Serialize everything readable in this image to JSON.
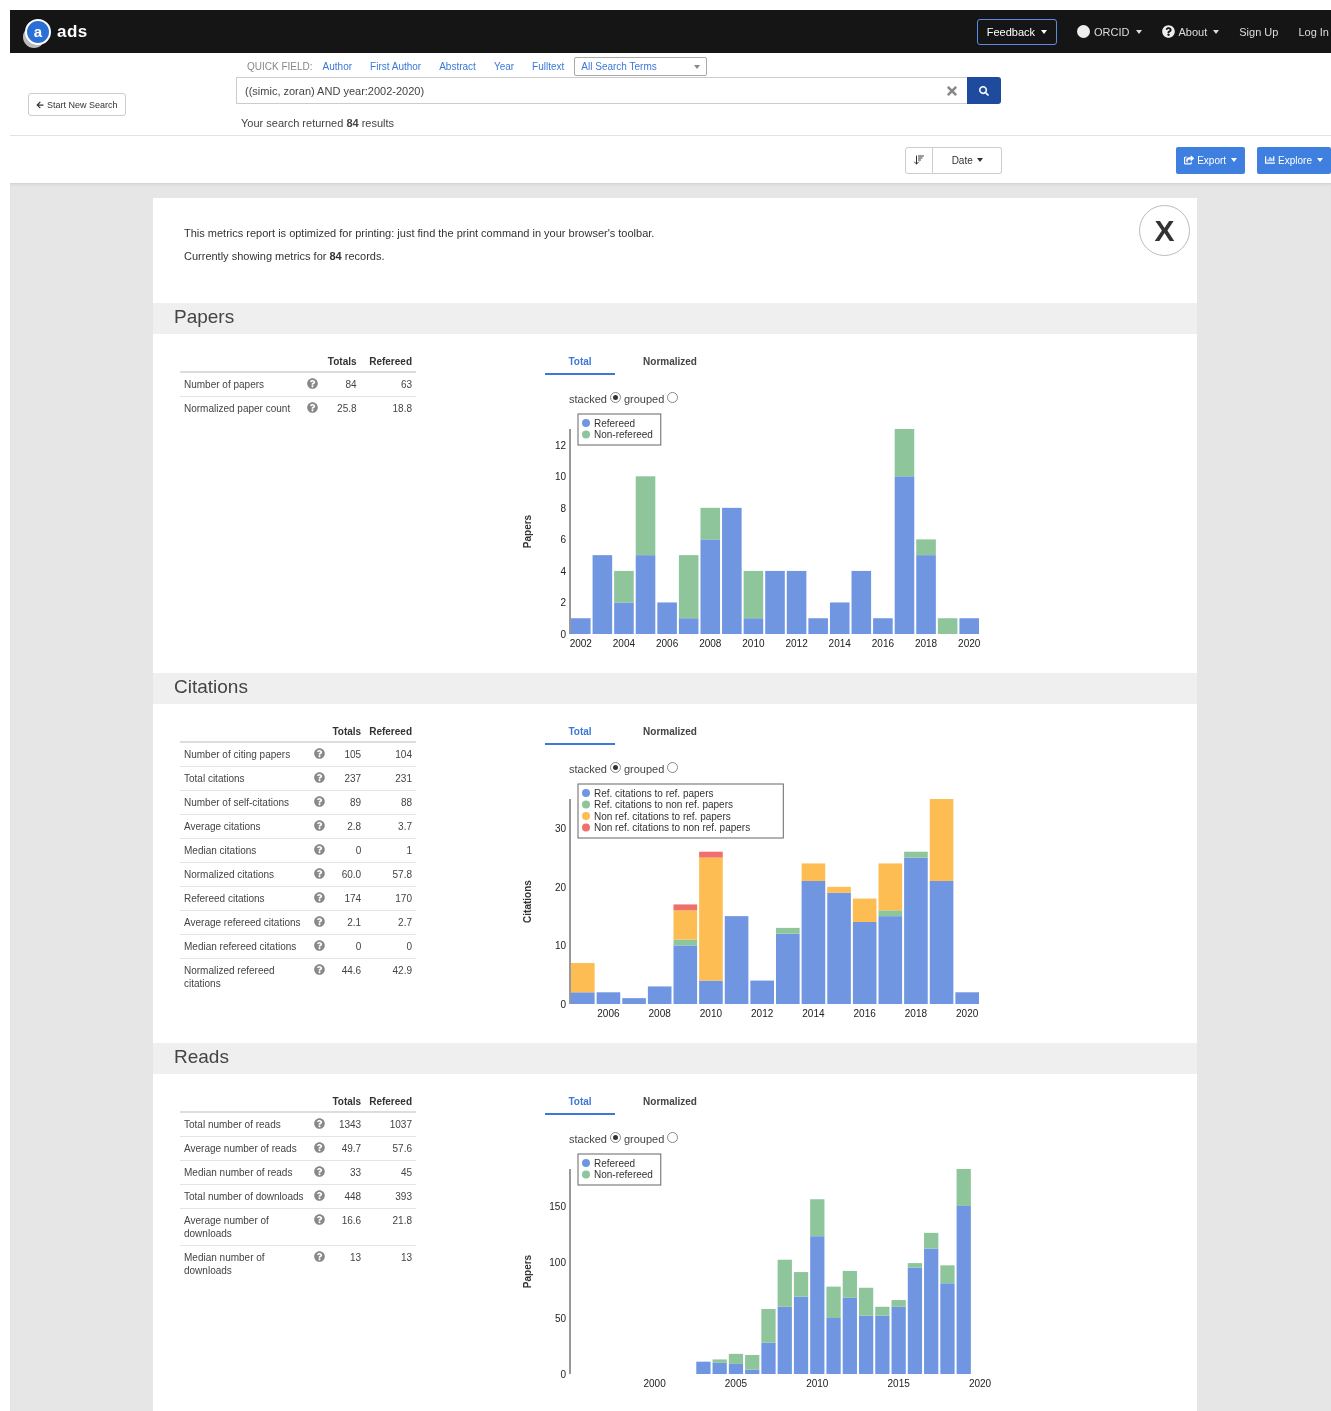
{
  "navbar": {
    "logo_mark": "a",
    "logo_text": "ads",
    "items": [
      {
        "label": "Feedback",
        "kind": "boxed",
        "caret": true
      },
      {
        "label": "ORCID",
        "kind": "orcid",
        "caret": true
      },
      {
        "label": "About",
        "kind": "help",
        "caret": true
      },
      {
        "label": "Sign Up",
        "kind": "link",
        "caret": false
      },
      {
        "label": "Log In",
        "kind": "link",
        "caret": false
      }
    ]
  },
  "search": {
    "start_new_search": "Start New Search",
    "quick_field_label": "QUICK FIELD:",
    "quick_fields": [
      "Author",
      "First Author",
      "Abstract",
      "Year",
      "Fulltext"
    ],
    "field_select": "All Search Terms",
    "query": "((simic, zoran) AND year:2002-2020)",
    "result": "Your search returned **84** results"
  },
  "toolbar": {
    "sort": "Date",
    "export": "Export",
    "explore": "Explore"
  },
  "report": {
    "close": "X",
    "notes": [
      "This metrics report is optimized for printing: just find the print command in your browser's toolbar.",
      "Currently showing metrics for **84** records."
    ],
    "sections": [
      {
        "title": "Papers",
        "table": {
          "columns": [
            "Totals",
            "Refereed"
          ],
          "rows": [
            {
              "label": "Number of papers",
              "totals": "84",
              "refereed": "63"
            },
            {
              "label": "Normalized paper count",
              "totals": "25.8",
              "refereed": "18.8"
            }
          ]
        },
        "tabs": [
          {
            "label": "Total",
            "selected": true
          },
          {
            "label": "Normalized",
            "selected": false
          }
        ],
        "options": [
          {
            "label": "stacked",
            "selected": true
          },
          {
            "label": "grouped",
            "selected": false
          }
        ],
        "chart_data": {
          "type": "bar",
          "ylabel": "Papers",
          "stacked": true,
          "legend": "upper left",
          "x": [
            2002,
            2003,
            2004,
            2005,
            2006,
            2007,
            2008,
            2009,
            2010,
            2011,
            2012,
            2013,
            2014,
            2015,
            2016,
            2017,
            2018,
            2019,
            2020
          ],
          "xlim": [
            2001.5,
            2020.5
          ],
          "ylim": [
            0,
            13
          ],
          "xticks": [
            2002,
            2004,
            2006,
            2008,
            2010,
            2012,
            2014,
            2016,
            2018,
            2020
          ],
          "yticks": [
            0,
            2,
            4,
            6,
            8,
            10,
            12
          ],
          "series": [
            {
              "name": "Refereed",
              "color": "#7096e2",
              "values": [
                1,
                5,
                2,
                5,
                2,
                1,
                6,
                8,
                1,
                4,
                4,
                1,
                2,
                4,
                1,
                10,
                5,
                0,
                1
              ]
            },
            {
              "name": "Non-refereed",
              "color": "#8ec59b",
              "values": [
                0,
                0,
                2,
                5,
                0,
                4,
                2,
                0,
                3,
                0,
                0,
                0,
                0,
                0,
                0,
                3,
                1,
                1,
                0
              ]
            }
          ]
        }
      },
      {
        "title": "Citations",
        "table": {
          "columns": [
            "Totals",
            "Refereed"
          ],
          "rows": [
            {
              "label": "Number of citing papers",
              "totals": "105",
              "refereed": "104"
            },
            {
              "label": "Total citations",
              "totals": "237",
              "refereed": "231"
            },
            {
              "label": "Number of self-citations",
              "totals": "89",
              "refereed": "88"
            },
            {
              "label": "Average citations",
              "totals": "2.8",
              "refereed": "3.7"
            },
            {
              "label": "Median citations",
              "totals": "0",
              "refereed": "1"
            },
            {
              "label": "Normalized citations",
              "totals": "60.0",
              "refereed": "57.8"
            },
            {
              "label": "Refereed citations",
              "totals": "174",
              "refereed": "170"
            },
            {
              "label": "Average refereed citations",
              "totals": "2.1",
              "refereed": "2.7"
            },
            {
              "label": "Median refereed citations",
              "totals": "0",
              "refereed": "0"
            },
            {
              "label": "Normalized refereed citations",
              "totals": "44.6",
              "refereed": "42.9"
            }
          ]
        },
        "tabs": [
          {
            "label": "Total",
            "selected": true
          },
          {
            "label": "Normalized",
            "selected": false
          }
        ],
        "options": [
          {
            "label": "stacked",
            "selected": true
          },
          {
            "label": "grouped",
            "selected": false
          }
        ],
        "chart_data": {
          "type": "bar",
          "ylabel": "Citations",
          "stacked": true,
          "legend": "upper left",
          "x": [
            2005,
            2006,
            2007,
            2008,
            2009,
            2010,
            2011,
            2012,
            2013,
            2014,
            2015,
            2016,
            2017,
            2018,
            2019,
            2020
          ],
          "xlim": [
            2004.5,
            2020.5
          ],
          "ylim": [
            0,
            35
          ],
          "xticks": [
            2006,
            2008,
            2010,
            2012,
            2014,
            2016,
            2018,
            2020
          ],
          "yticks": [
            0,
            10,
            20,
            30
          ],
          "series": [
            {
              "name": "Ref. citations to ref. papers",
              "color": "#7096e2",
              "values": [
                2,
                2,
                1,
                3,
                10,
                4,
                15,
                4,
                12,
                21,
                19,
                14,
                15,
                25,
                21,
                2
              ]
            },
            {
              "name": "Ref. citations to non ref. papers",
              "color": "#8ec59b",
              "values": [
                0,
                0,
                0,
                0,
                1,
                0,
                0,
                0,
                1,
                0,
                0,
                0,
                1,
                1,
                0,
                0
              ]
            },
            {
              "name": "Non ref. citations to ref. papers",
              "color": "#fdbd53",
              "values": [
                5,
                0,
                0,
                0,
                5,
                21,
                0,
                0,
                0,
                3,
                1,
                4,
                8,
                0,
                14,
                0
              ]
            },
            {
              "name": "Non ref. citations to non ref. papers",
              "color": "#ee6f6c",
              "values": [
                0,
                0,
                0,
                0,
                1,
                1,
                0,
                0,
                0,
                0,
                0,
                0,
                0,
                0,
                0,
                0
              ]
            }
          ]
        }
      },
      {
        "title": "Reads",
        "table": {
          "columns": [
            "Totals",
            "Refereed"
          ],
          "rows": [
            {
              "label": "Total number of reads",
              "totals": "1343",
              "refereed": "1037"
            },
            {
              "label": "Average number of reads",
              "totals": "49.7",
              "refereed": "57.6"
            },
            {
              "label": "Median number of reads",
              "totals": "33",
              "refereed": "45"
            },
            {
              "label": "Total number of downloads",
              "totals": "448",
              "refereed": "393"
            },
            {
              "label": "Average number of downloads",
              "totals": "16.6",
              "refereed": "21.8"
            },
            {
              "label": "Median number of downloads",
              "totals": "13",
              "refereed": "13"
            }
          ]
        },
        "tabs": [
          {
            "label": "Total",
            "selected": true
          },
          {
            "label": "Normalized",
            "selected": false
          }
        ],
        "options": [
          {
            "label": "stacked",
            "selected": true
          },
          {
            "label": "grouped",
            "selected": false
          }
        ],
        "chart_data": {
          "type": "bar",
          "ylabel": "Papers",
          "stacked": true,
          "legend": "upper left",
          "x": [
            2003,
            2004,
            2005,
            2006,
            2007,
            2008,
            2009,
            2010,
            2011,
            2012,
            2013,
            2014,
            2015,
            2016,
            2017,
            2018,
            2019
          ],
          "xlim": [
            1994.8,
            2020
          ],
          "ylim": [
            0,
            183
          ],
          "xticks": [
            2000,
            2005,
            2010,
            2015,
            2020
          ],
          "yticks": [
            0,
            50,
            100,
            150
          ],
          "series": [
            {
              "name": "Refereed",
              "color": "#7096e2",
              "values": [
                11,
                10,
                9,
                4,
                28,
                60,
                69,
                123,
                50,
                68,
                52,
                52,
                60,
                95,
                112,
                81,
                150
              ]
            },
            {
              "name": "Non-refereed",
              "color": "#8ec59b",
              "values": [
                0,
                3,
                9,
                13,
                30,
                42,
                22,
                33,
                28,
                24,
                25,
                8,
                6,
                4,
                14,
                16,
                33
              ]
            }
          ]
        }
      }
    ]
  }
}
